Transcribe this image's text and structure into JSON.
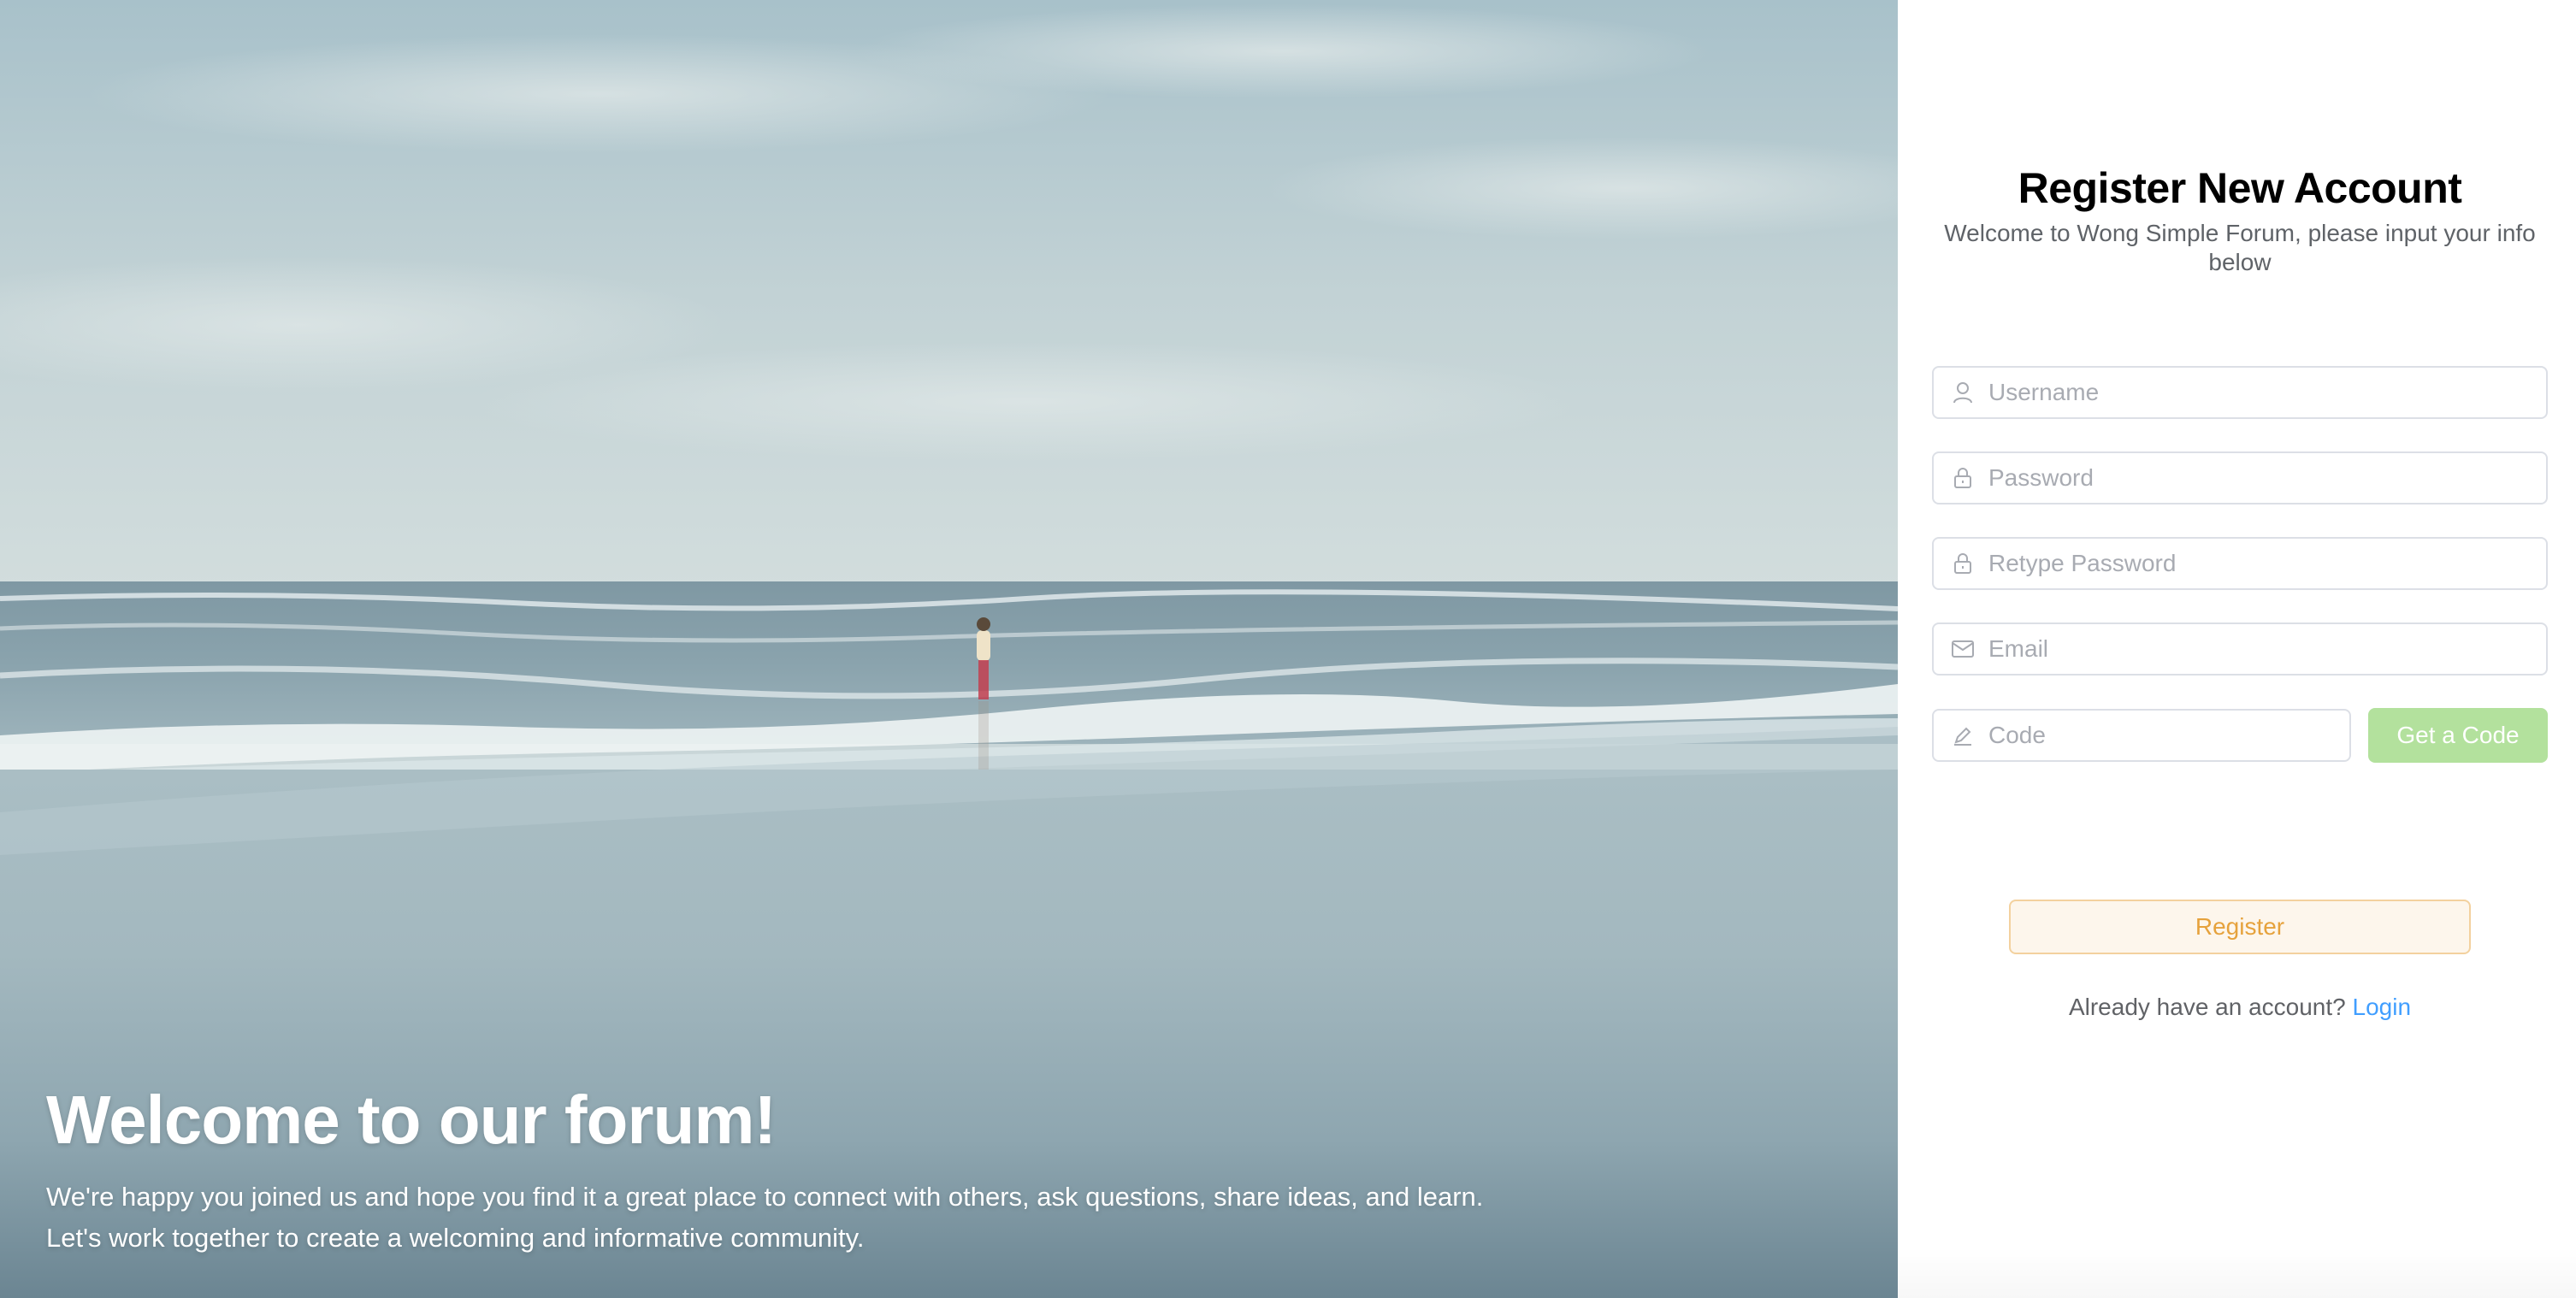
{
  "hero": {
    "title": "Welcome to our forum!",
    "subtitle_line1": "We're happy you joined us and hope you find it a great place to connect with others, ask questions, share ideas, and learn.",
    "subtitle_line2": "Let's work together to create a welcoming and informative community."
  },
  "register": {
    "title": "Register New Account",
    "subtitle": "Welcome to Wong Simple Forum, please input your info below",
    "fields": {
      "username": {
        "placeholder": "Username",
        "icon": "user-icon"
      },
      "password": {
        "placeholder": "Password",
        "icon": "lock-icon"
      },
      "retype_password": {
        "placeholder": "Retype Password",
        "icon": "lock-icon"
      },
      "email": {
        "placeholder": "Email",
        "icon": "envelope-icon"
      },
      "code": {
        "placeholder": "Code",
        "icon": "pen-icon"
      }
    },
    "get_code_label": "Get a Code",
    "register_label": "Register",
    "login_prompt": "Already have an account?",
    "login_link": "Login"
  },
  "colors": {
    "get_code_bg": "#b3e19d",
    "register_bg": "#fdf6ec",
    "register_border": "#f3d19e",
    "register_text": "#e6a23c",
    "link": "#409eff",
    "input_border": "#dcdfe6",
    "placeholder": "#a8abb2"
  }
}
